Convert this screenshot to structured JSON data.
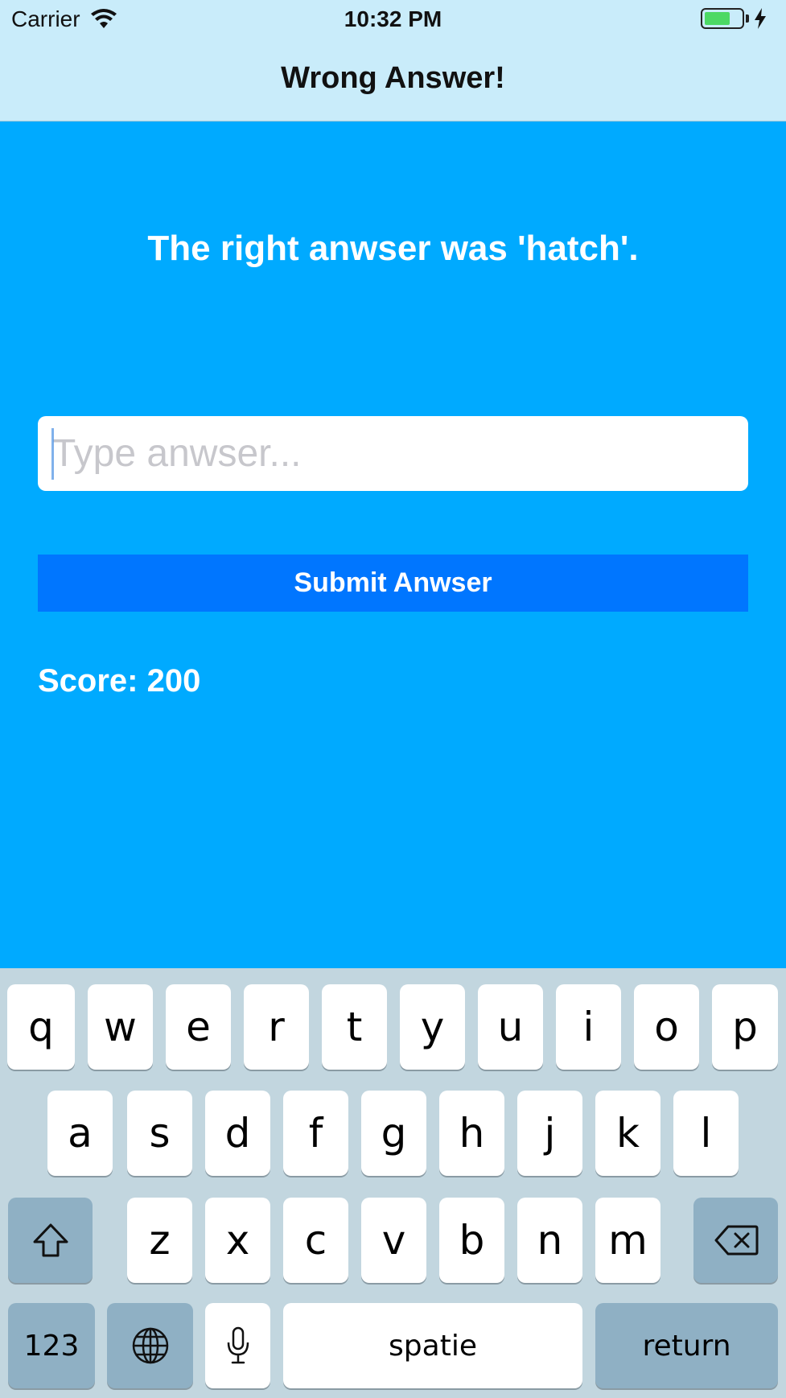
{
  "status_bar": {
    "carrier": "Carrier",
    "time": "10:32 PM",
    "wifi_icon": "wifi-icon",
    "battery_icon": "battery-icon",
    "charging_icon": "bolt-icon"
  },
  "nav": {
    "title": "Wrong Answer!"
  },
  "main": {
    "result_text": "The right anwser was 'hatch'.",
    "input": {
      "value": "",
      "placeholder": "Type anwser..."
    },
    "submit_label": "Submit Anwser",
    "score_text": "Score: 200"
  },
  "keyboard": {
    "row1": [
      "q",
      "w",
      "e",
      "r",
      "t",
      "y",
      "u",
      "i",
      "o",
      "p"
    ],
    "row2": [
      "a",
      "s",
      "d",
      "f",
      "g",
      "h",
      "j",
      "k",
      "l"
    ],
    "row3": [
      "z",
      "x",
      "c",
      "v",
      "b",
      "n",
      "m"
    ],
    "numbers_label": "123",
    "space_label": "spatie",
    "return_label": "return",
    "shift_icon": "shift-icon",
    "delete_icon": "delete-icon",
    "globe_icon": "globe-icon",
    "mic_icon": "microphone-icon"
  },
  "colors": {
    "background": "#00aaff",
    "nav_background": "#c9ecfa",
    "submit_button": "#0076ff",
    "keyboard_background": "#c2d6df",
    "battery_fill": "#4cd964"
  }
}
